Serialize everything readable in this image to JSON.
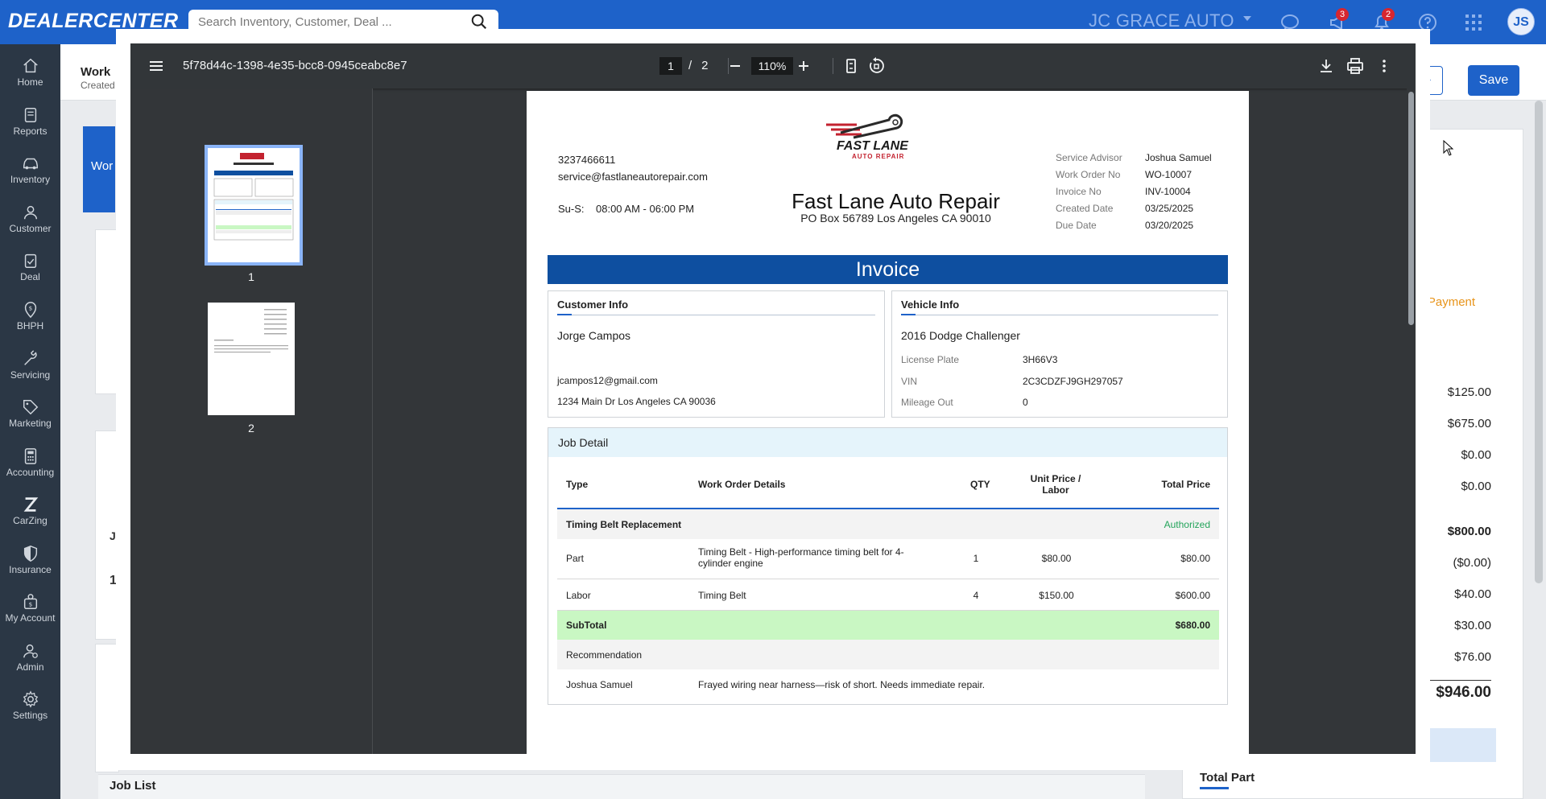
{
  "topbar": {
    "logo": "DEALERCENTER",
    "search_placeholder": "Search Inventory, Customer, Deal ...",
    "dealer": "JC GRACE AUTO",
    "badge_messages": "3",
    "badge_notifications": "2",
    "avatar_initials": "JS"
  },
  "sidebar": {
    "items": [
      {
        "label": "Home",
        "icon": "home-icon"
      },
      {
        "label": "Reports",
        "icon": "reports-icon"
      },
      {
        "label": "Inventory",
        "icon": "car-icon"
      },
      {
        "label": "Customer",
        "icon": "person-icon"
      },
      {
        "label": "Deal",
        "icon": "clipboard-icon"
      },
      {
        "label": "BHPH",
        "icon": "dollar-pin-icon"
      },
      {
        "label": "Servicing",
        "icon": "wrench-icon"
      },
      {
        "label": "Marketing",
        "icon": "tag-icon"
      },
      {
        "label": "Accounting",
        "icon": "calculator-icon"
      },
      {
        "label": "CarZing",
        "icon": "z-icon"
      },
      {
        "label": "Insurance",
        "icon": "shield-icon"
      },
      {
        "label": "My Account",
        "icon": "account-icon"
      },
      {
        "label": "Admin",
        "icon": "admin-icon"
      },
      {
        "label": "Settings",
        "icon": "gear-icon"
      }
    ]
  },
  "background": {
    "work_title": "Work",
    "created_label": "Created",
    "wo_text": "Wor",
    "save_label": "Save",
    "pending_payment": "ng Payment",
    "j": "J",
    "one": "1",
    "job_list": "Job List",
    "amounts": [
      "$125.00",
      "$675.00",
      "$0.00",
      "$0.00",
      "$800.00",
      "($0.00)",
      "$40.00",
      "$30.00",
      "$76.00"
    ],
    "total": "$946.00",
    "total_part": "Total Part"
  },
  "viewer": {
    "doc_title": "5f78d44c-1398-4e35-bcc8-0945ceabc8e7",
    "current_page": "1",
    "page_separator": "/",
    "total_pages": "2",
    "zoom": "110%",
    "thumb_labels": [
      "1",
      "2"
    ]
  },
  "invoice": {
    "phone": "3237466611",
    "email": "service@fastlaneautorepair.com",
    "hours_label": "Su-S:",
    "hours": "08:00 AM - 06:00 PM",
    "logo_title": "FAST LANE",
    "logo_subtitle": "AUTO REPAIR",
    "business_name": "Fast Lane Auto Repair",
    "business_address": "PO Box 56789 Los Angeles CA 90010",
    "meta": [
      {
        "label": "Service Advisor",
        "value": "Joshua Samuel"
      },
      {
        "label": "Work Order No",
        "value": "WO-10007"
      },
      {
        "label": "Invoice No",
        "value": "INV-10004"
      },
      {
        "label": "Created Date",
        "value": "03/25/2025"
      },
      {
        "label": "Due Date",
        "value": "03/20/2025"
      }
    ],
    "heading": "Invoice",
    "customer": {
      "title": "Customer Info",
      "name": "Jorge Campos",
      "email": "jcampos12@gmail.com",
      "address": "1234 Main Dr Los Angeles CA 90036"
    },
    "vehicle": {
      "title": "Vehicle Info",
      "car": "2016 Dodge Challenger",
      "fields": [
        {
          "label": "License Plate",
          "value": "3H66V3"
        },
        {
          "label": "VIN",
          "value": "2C3CDZFJ9GH297057"
        },
        {
          "label": "Mileage Out",
          "value": "0"
        }
      ]
    },
    "job": {
      "title": "Job Detail",
      "headers": {
        "type": "Type",
        "details": "Work Order Details",
        "qty": "QTY",
        "unit_1": "Unit Price /",
        "unit_2": "Labor",
        "total": "Total Price"
      },
      "service_name": "Timing Belt Replacement",
      "service_status": "Authorized",
      "rows": [
        {
          "type": "Part",
          "details_1": "Timing Belt - High-performance timing belt for 4-",
          "details_2": "cylinder engine",
          "qty": "1",
          "unit": "$80.00",
          "total": "$80.00"
        },
        {
          "type": "Labor",
          "details_1": "Timing Belt",
          "details_2": "",
          "qty": "4",
          "unit": "$150.00",
          "total": "$600.00"
        }
      ],
      "subtotal_label": "SubTotal",
      "subtotal_value": "$680.00",
      "recommendation_label": "Recommendation",
      "recommendation_by": "Joshua Samuel",
      "recommendation_text": "Frayed wiring near harness—risk of short. Needs immediate repair."
    }
  }
}
